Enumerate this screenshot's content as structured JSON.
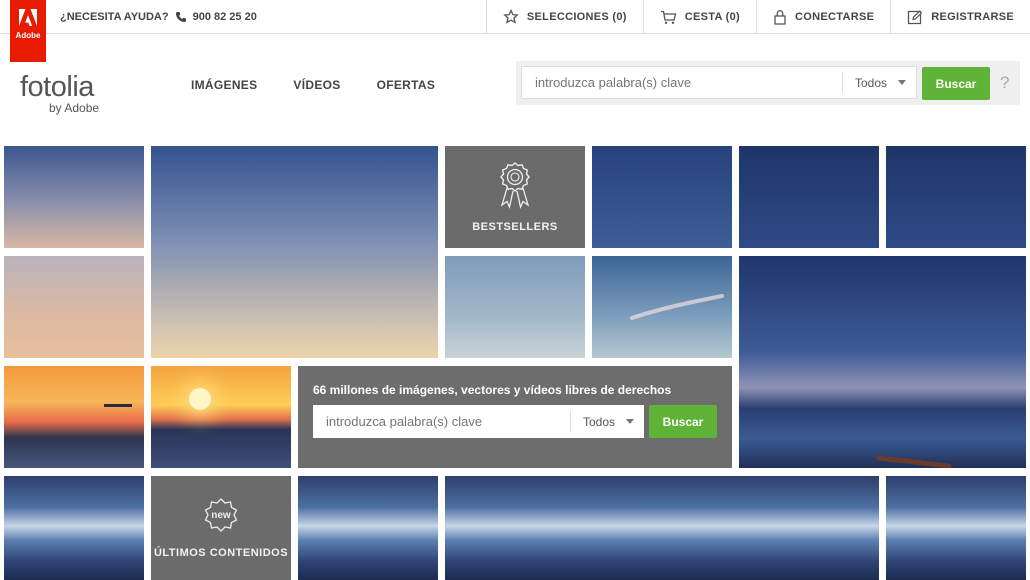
{
  "brand": {
    "adobe_label": "Adobe",
    "logo_word": "fotolia",
    "logo_by": "by Adobe",
    "accent_red": "#e81b00",
    "accent_green": "#5fb336"
  },
  "topbar": {
    "help_label": "¿NECESITA AYUDA?",
    "phone": "900 82 25 20",
    "links": [
      {
        "label": "SELECCIONES (0)",
        "icon": "star-icon"
      },
      {
        "label": "CESTA (0)",
        "icon": "cart-icon"
      },
      {
        "label": "CONECTARSE",
        "icon": "lock-icon"
      },
      {
        "label": "REGISTRARSE",
        "icon": "edit-icon"
      }
    ]
  },
  "nav": {
    "items": [
      "IMÁGENES",
      "VÍDEOS",
      "OFERTAS"
    ]
  },
  "header_search": {
    "placeholder": "introduzca palabra(s) clave",
    "filter_value": "Todos",
    "button_label": "Buscar",
    "help_symbol": "?"
  },
  "tiles": {
    "bestsellers_label": "BESTSELLERS",
    "latest_label": "ÚLTIMOS CONTENIDOS",
    "new_badge": "new"
  },
  "center_search": {
    "title": "66 millones de imágenes, vectores y vídeos libres de derechos",
    "placeholder": "introduzca palabra(s) clave",
    "filter_value": "Todos",
    "button_label": "Buscar"
  }
}
